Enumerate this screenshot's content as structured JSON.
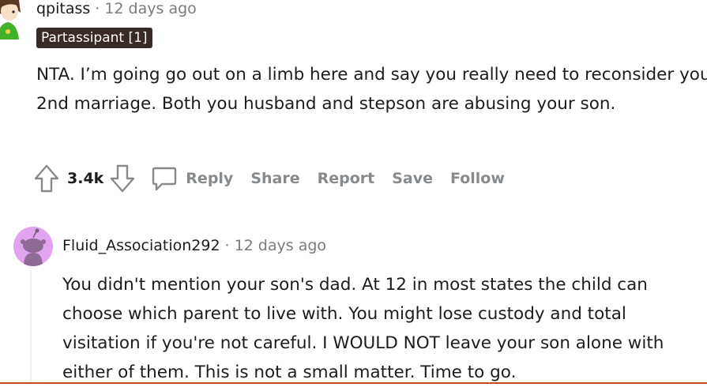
{
  "comments": [
    {
      "username": "qpitass",
      "separator": "·",
      "timestamp": "12 days ago",
      "flair": "Partassipant [1]",
      "body": [
        "NTA. I’m going go out on a limb here and say you really need to reconsider you 2nd marriage. Both you husband and stepson are abusing your son."
      ],
      "actions": {
        "upvote_icon": "upvote-arrow-icon",
        "vote_count": "3.4k",
        "downvote_icon": "downvote-arrow-icon",
        "comment_icon": "comment-bubble-icon",
        "reply": "Reply",
        "share": "Share",
        "report": "Report",
        "save": "Save",
        "follow": "Follow"
      },
      "colors": {
        "flair_bg": "#3a2a25",
        "flair_text": "#ffffff"
      }
    },
    {
      "username": "Fluid_Association292",
      "separator": "·",
      "timestamp": "12 days ago",
      "avatar_icon": "snoo-avatar-icon",
      "avatar_bg": "#e2a3f0",
      "body": [
        "You didn't mention your son's dad. At 12 in most states the child can choose which parent to live with. You might lose custody and total visitation if you're not careful. I WOULD NOT leave your son alone with either of them. This is not a small matter. Time to go."
      ]
    }
  ]
}
